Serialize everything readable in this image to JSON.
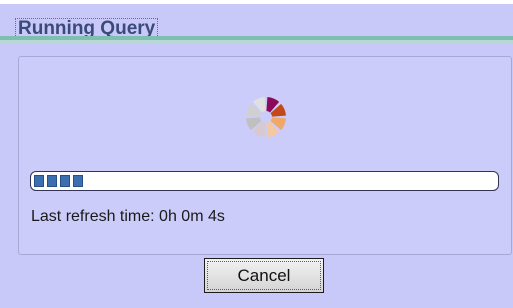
{
  "dialog": {
    "title": "Running Query",
    "progress_fraction": 0.09,
    "refresh_label": "Last refresh time: 0h 0m 4s",
    "cancel_label": "Cancel"
  },
  "spinner": {
    "icon": "loading-spinner-icon",
    "colors": [
      "#8a0a5a",
      "#c24a1a",
      "#f0a868",
      "#f4c8a0",
      "#d8c8d0",
      "#c0c0c0",
      "#d0d0d0",
      "#e0e0e0"
    ]
  },
  "progress_bar": {
    "segments_shown": 4,
    "segment_color": "#3b6fb0"
  }
}
